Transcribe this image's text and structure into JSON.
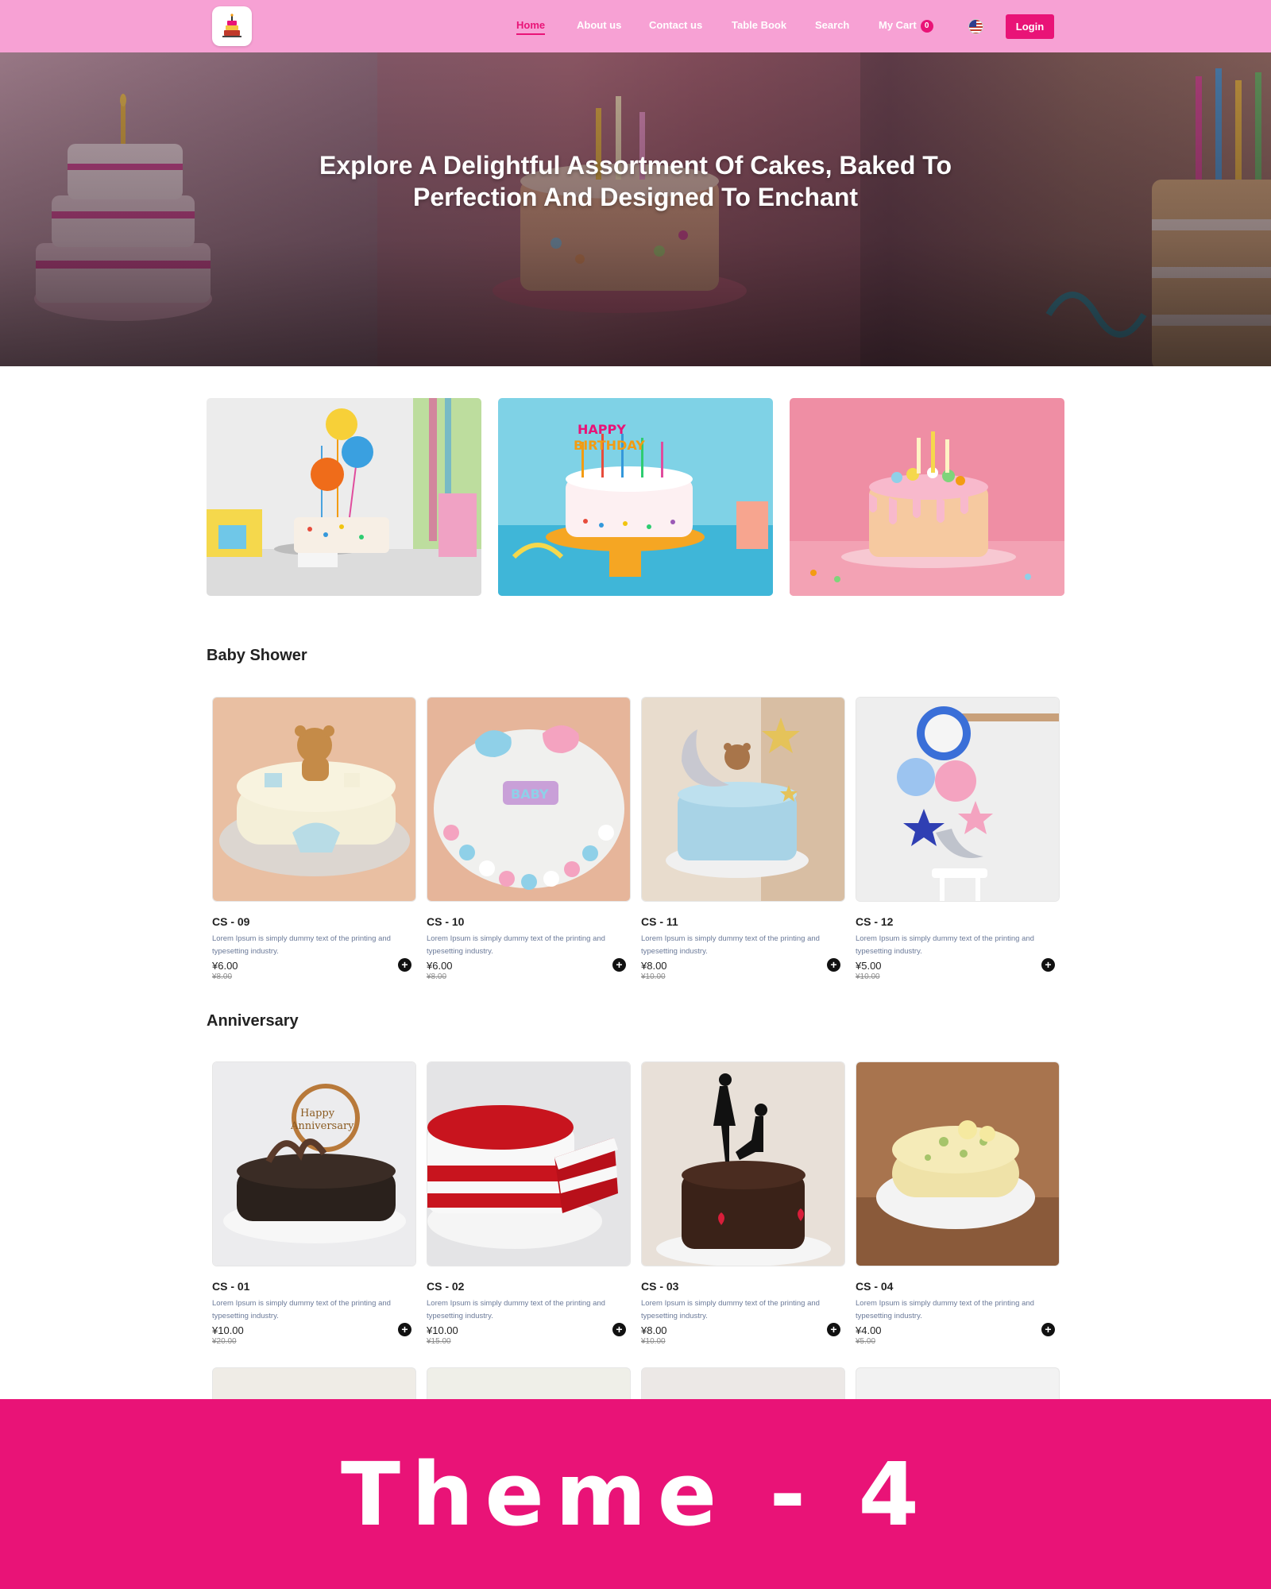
{
  "nav": {
    "items": [
      {
        "label": "Home",
        "active": true
      },
      {
        "label": "About us"
      },
      {
        "label": "Contact us"
      },
      {
        "label": "Table Book"
      },
      {
        "label": "Search"
      },
      {
        "label": "My Cart"
      }
    ],
    "cart_count": "0",
    "login_label": "Login",
    "brand_color": "#e91377",
    "nav_bg": "#f7a1d4",
    "flag_icon": "us-flag-icon"
  },
  "hero": {
    "title": "Explore A Delightful Assortment Of Cakes, Baked To Perfection And Designed To Enchant"
  },
  "sections": [
    {
      "title": "Baby Shower",
      "products": [
        {
          "name": "CS - 09",
          "desc": "Lorem Ipsum is simply dummy text of the printing and typesetting industry.",
          "price": "¥6.00",
          "old_price": "¥8.00"
        },
        {
          "name": "CS - 10",
          "desc": "Lorem Ipsum is simply dummy text of the printing and typesetting industry.",
          "price": "¥6.00",
          "old_price": "¥8.00"
        },
        {
          "name": "CS - 11",
          "desc": "Lorem Ipsum is simply dummy text of the printing and typesetting industry.",
          "price": "¥8.00",
          "old_price": "¥10.00"
        },
        {
          "name": "CS - 12",
          "desc": "Lorem Ipsum is simply dummy text of the printing and typesetting industry.",
          "price": "¥5.00",
          "old_price": "¥10.00"
        }
      ]
    },
    {
      "title": "Anniversary",
      "products": [
        {
          "name": "CS - 01",
          "desc": "Lorem Ipsum is simply dummy text of the printing and typesetting industry.",
          "price": "¥10.00",
          "old_price": "¥20.00"
        },
        {
          "name": "CS - 02",
          "desc": "Lorem Ipsum is simply dummy text of the printing and typesetting industry.",
          "price": "¥10.00",
          "old_price": "¥15.00"
        },
        {
          "name": "CS - 03",
          "desc": "Lorem Ipsum is simply dummy text of the printing and typesetting industry.",
          "price": "¥8.00",
          "old_price": "¥10.00"
        },
        {
          "name": "CS - 04",
          "desc": "Lorem Ipsum is simply dummy text of the printing and typesetting industry.",
          "price": "¥4.00",
          "old_price": "¥5.00"
        }
      ]
    }
  ],
  "theme_label": "Theme - 4"
}
